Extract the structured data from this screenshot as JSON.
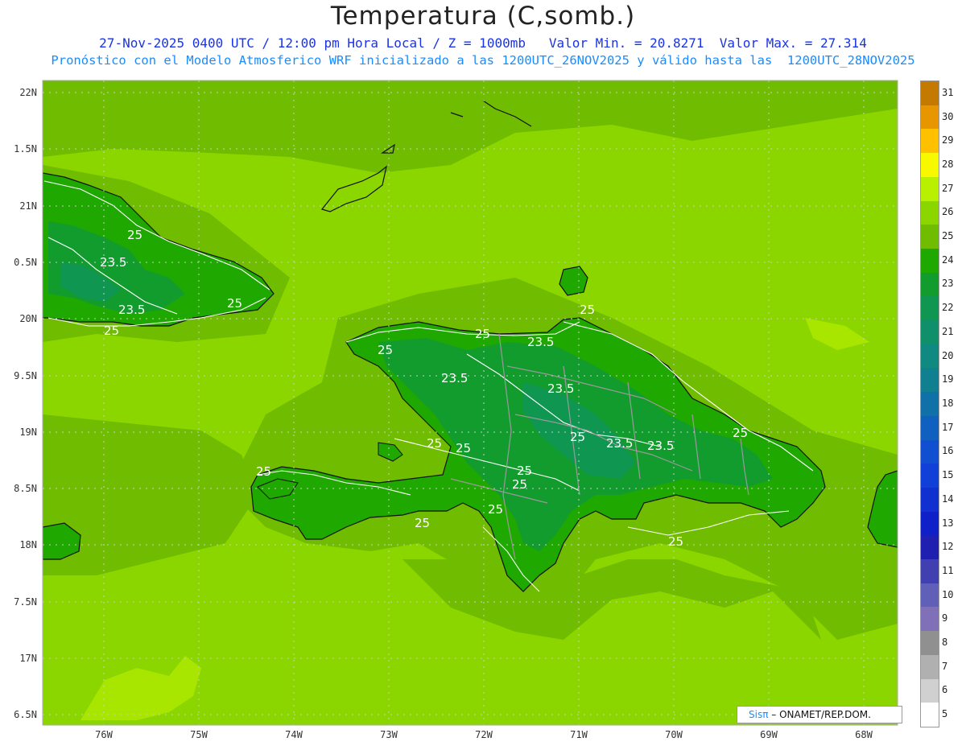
{
  "title": "Temperatura (C,somb.)",
  "subtitle_line1": "27-Nov-2025 0400 UTC / 12:00 pm Hora Local / Z = 1000mb   Valor Min. = 20.8271  Valor Max. = 27.314",
  "subtitle_line2": "Pronóstico con el Modelo Atmosferico WRF inicializado a las 1200UTC_26NOV2025 y válido hasta las  1200UTC_28NOV2025",
  "map": {
    "lat_ticks": [
      "22N",
      "1.5N",
      "21N",
      "0.5N",
      "20N",
      "9.5N",
      "19N",
      "8.5N",
      "18N",
      "7.5N",
      "17N",
      "6.5N"
    ],
    "lon_ticks": [
      "76W",
      "75W",
      "74W",
      "73W",
      "72W",
      "71W",
      "70W",
      "69W",
      "68W"
    ],
    "contour_labels": [
      "25",
      "23.5",
      "23.5",
      "25",
      "25",
      "25",
      "25",
      "23.5",
      "23.5",
      "23.5",
      "23.5",
      "23.5",
      "25",
      "25",
      "25",
      "25",
      "25",
      "25",
      "25",
      "25",
      "25",
      "25",
      "25"
    ],
    "colors": {
      "ocean_light": "#8cd600",
      "ocean_mid": "#6fbc00",
      "ocean_dark": "#55a800",
      "land_24": "#1fa800",
      "land_23": "#129c2e",
      "land_22": "#0f9650",
      "pale_26": "#a8e600",
      "coast": "#111111",
      "borders": "#999999",
      "contour": "#ffffff"
    }
  },
  "colorbar": {
    "labels": [
      "31",
      "30",
      "29",
      "28",
      "27",
      "26",
      "25",
      "24",
      "23",
      "22",
      "21",
      "20",
      "19",
      "18",
      "17",
      "16",
      "15",
      "14",
      "13",
      "12",
      "11",
      "10",
      "9",
      "8",
      "7",
      "6",
      "5"
    ],
    "colors": [
      "#c47a00",
      "#e89600",
      "#ffc000",
      "#f8f800",
      "#b8f000",
      "#8cd600",
      "#6fbc00",
      "#1fa800",
      "#129c2e",
      "#0f9650",
      "#10906a",
      "#108a80",
      "#108090",
      "#1070a8",
      "#1060c0",
      "#1050d0",
      "#1040d8",
      "#1030d0",
      "#1020c8",
      "#2020b0",
      "#4040b0",
      "#6060b8",
      "#8070b8",
      "#909090",
      "#b0b0b0",
      "#d0d0d0",
      "#ffffff"
    ]
  },
  "credit": {
    "brand": "Sisπ",
    "org": " – ONAMET/REP.DOM."
  }
}
